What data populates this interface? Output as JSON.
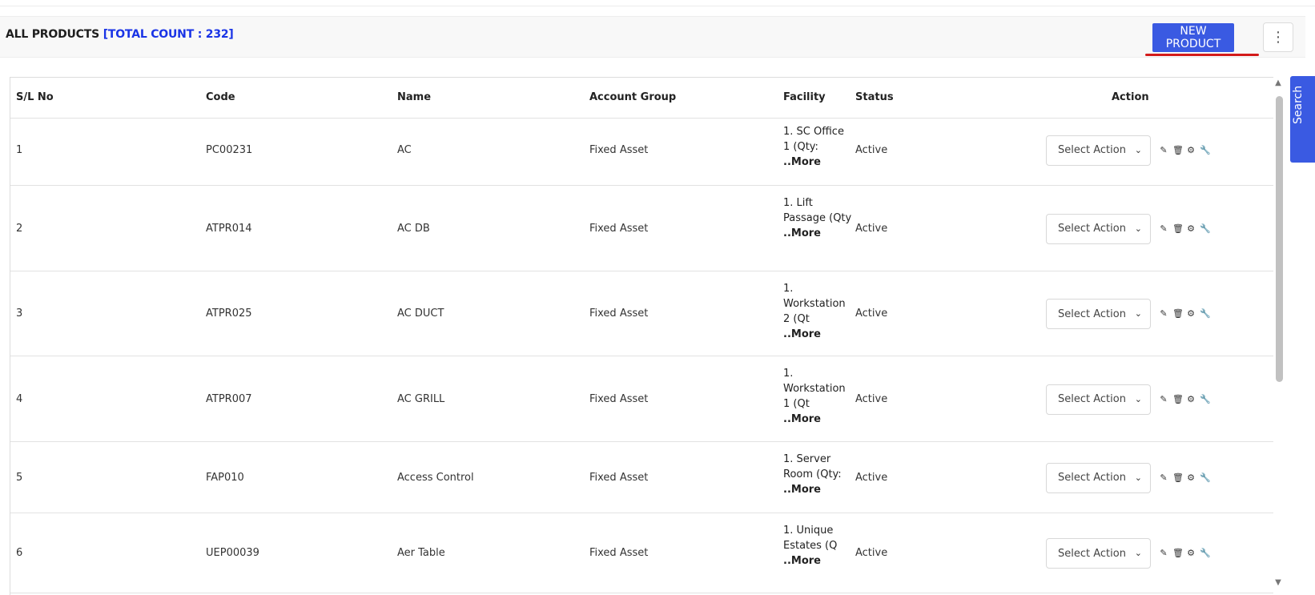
{
  "header": {
    "title": "ALL PRODUCTS",
    "count_text": "[TOTAL COUNT : 232]",
    "new_button": "NEW PRODUCT",
    "more_icon": "⋮"
  },
  "table": {
    "columns": [
      "S/L No",
      "Code",
      "Name",
      "Account Group",
      "Facility",
      "Status",
      "Action"
    ],
    "select_placeholder": "Select Action",
    "more_text": "..More",
    "rows": [
      {
        "sl": "1",
        "code": "PC00231",
        "name": "AC",
        "group": "Fixed Asset",
        "facility": "1. SC Office 1 (Qty:",
        "status": "Active"
      },
      {
        "sl": "2",
        "code": "ATPR014",
        "name": "AC DB",
        "group": "Fixed Asset",
        "facility": "1. Lift Passage (Qty",
        "status": "Active"
      },
      {
        "sl": "3",
        "code": "ATPR025",
        "name": "AC DUCT",
        "group": "Fixed Asset",
        "facility": "1. Workstation 2 (Qt",
        "status": "Active"
      },
      {
        "sl": "4",
        "code": "ATPR007",
        "name": "AC GRILL",
        "group": "Fixed Asset",
        "facility": "1. Workstation 1 (Qt",
        "status": "Active"
      },
      {
        "sl": "5",
        "code": "FAP010",
        "name": "Access Control",
        "group": "Fixed Asset",
        "facility": "1. Server Room (Qty:",
        "status": "Active"
      },
      {
        "sl": "6",
        "code": "UEP00039",
        "name": "Aer Table",
        "group": "Fixed Asset",
        "facility": "1. Unique Estates (Q",
        "status": "Active"
      }
    ]
  },
  "side_tab": {
    "label": "Search"
  },
  "icons": [
    "pencil-icon",
    "trash-icon",
    "gears-icon",
    "wrench-icon"
  ],
  "colors": {
    "accent": "#3a5ae2",
    "count": "#1a34e6",
    "underline": "#d31a1a"
  }
}
